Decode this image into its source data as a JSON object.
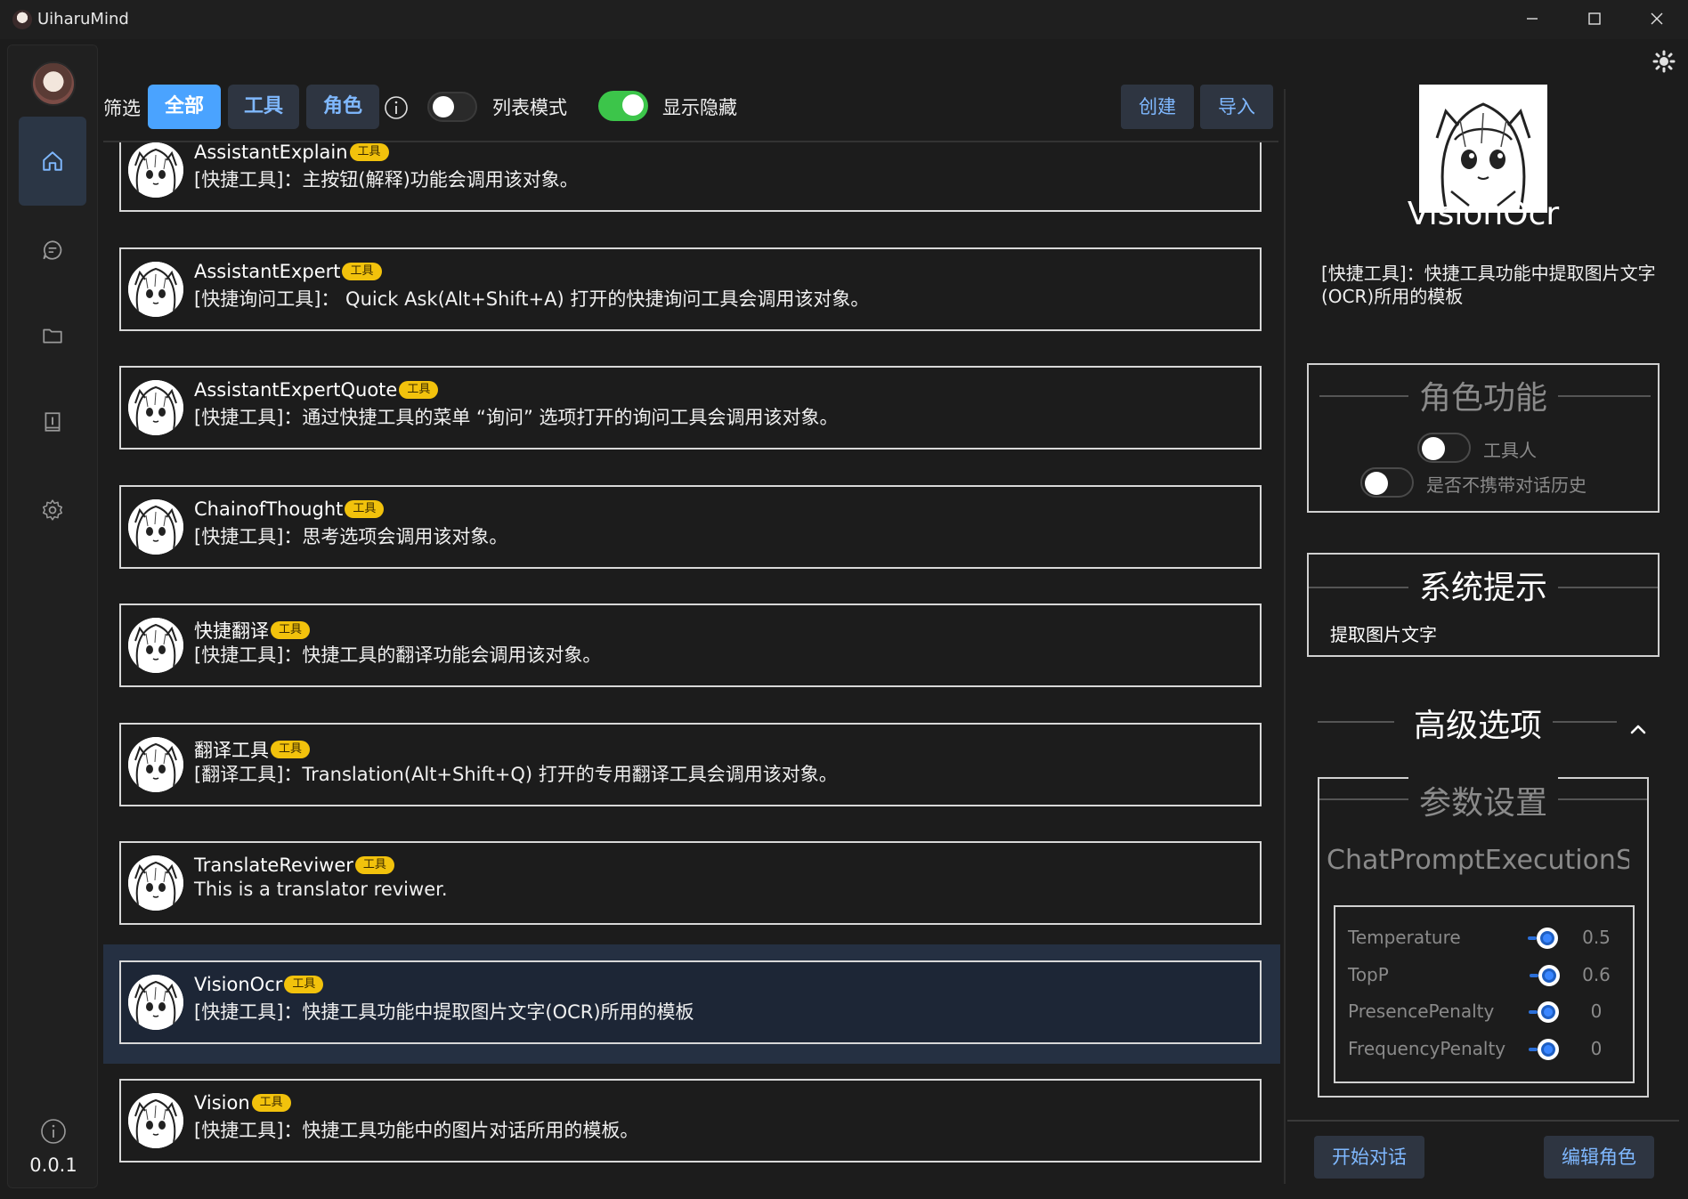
{
  "window": {
    "title": "UiharuMind",
    "controls": [
      "minimize-icon",
      "maximize-icon",
      "close-icon"
    ]
  },
  "sidebar": {
    "items": [
      {
        "name": "home",
        "icon": "home-icon",
        "active": true
      },
      {
        "name": "chat",
        "icon": "chat-bubble-icon",
        "active": false
      },
      {
        "name": "folder",
        "icon": "folder-icon",
        "active": false
      },
      {
        "name": "book",
        "icon": "book-icon",
        "active": false
      },
      {
        "name": "settings",
        "icon": "gear-icon",
        "active": false
      }
    ],
    "version": "0.0.1"
  },
  "toolbar": {
    "filter_label": "筛选",
    "filters": [
      {
        "label": "全部",
        "active": true
      },
      {
        "label": "工具",
        "active": false
      },
      {
        "label": "角色",
        "active": false
      }
    ],
    "list_mode_label": "列表模式",
    "list_mode_on": false,
    "show_hidden_label": "显示隐藏",
    "show_hidden_on": true,
    "create_label": "创建",
    "import_label": "导入"
  },
  "list": {
    "items": [
      {
        "title": "AssistantExplain",
        "tag": "工具",
        "desc": "[快捷工具]：主按钮(解释)功能会调用该对象。",
        "selected": false
      },
      {
        "title": "AssistantExpert",
        "tag": "工具",
        "desc": "[快捷询问工具]： Quick Ask(Alt+Shift+A) 打开的快捷询问工具会调用该对象。",
        "selected": false
      },
      {
        "title": "AssistantExpertQuote",
        "tag": "工具",
        "desc": "[快捷工具]：通过快捷工具的菜单 “询问” 选项打开的询问工具会调用该对象。",
        "selected": false
      },
      {
        "title": "ChainofThought",
        "tag": "工具",
        "desc": "[快捷工具]：思考选项会调用该对象。",
        "selected": false
      },
      {
        "title": "快捷翻译",
        "tag": "工具",
        "desc": "[快捷工具]：快捷工具的翻译功能会调用该对象。",
        "selected": false
      },
      {
        "title": "翻译工具",
        "tag": "工具",
        "desc": "[翻译工具]：Translation(Alt+Shift+Q) 打开的专用翻译工具会调用该对象。",
        "selected": false
      },
      {
        "title": "TranslateReviwer",
        "tag": "工具",
        "desc": "This is a translator reviwer.",
        "selected": false
      },
      {
        "title": "VisionOcr",
        "tag": "工具",
        "desc": "[快捷工具]：快捷工具功能中提取图片文字(OCR)所用的模板",
        "selected": true
      },
      {
        "title": "Vision",
        "tag": "工具",
        "desc": "[快捷工具]：快捷工具功能中的图片对话所用的模板。",
        "selected": false
      }
    ]
  },
  "detail": {
    "name": "VisionOcr",
    "desc": "[快捷工具]：快捷工具功能中提取图片文字(OCR)所用的模板",
    "role_section_title": "角色功能",
    "role_toggles": [
      {
        "label": "工具人",
        "on": false
      },
      {
        "label": "是否不携带对话历史",
        "on": false
      }
    ],
    "system_prompt_title": "系统提示",
    "system_prompt_text": "提取图片文字",
    "advanced_title": "高级选项",
    "params_title": "参数设置",
    "exec_settings_title": "ChatPromptExecutionSe",
    "params": [
      {
        "name": "Temperature",
        "value": "0.5"
      },
      {
        "name": "TopP",
        "value": "0.6"
      },
      {
        "name": "PresencePenalty",
        "value": "0"
      },
      {
        "name": "FrequencyPenalty",
        "value": "0"
      }
    ],
    "start_chat_label": "开始对话",
    "edit_role_label": "编辑角色"
  },
  "colors": {
    "accent": "#4aa3ff",
    "tag_bg": "#f2c20c",
    "toggle_on": "#3cc54a",
    "selected_row": "#253042"
  }
}
